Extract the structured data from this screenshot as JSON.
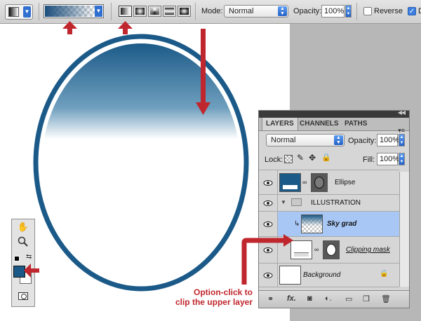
{
  "options_bar": {
    "mode_label": "Mode:",
    "mode_value": "Normal",
    "opacity_label": "Opacity:",
    "opacity_value": "100%",
    "reverse_label": "Reverse",
    "reverse_checked": false,
    "dither_label": "Di",
    "dither_checked": true,
    "gradient_types": [
      "linear-gradient-icon",
      "radial-gradient-icon",
      "angle-gradient-icon",
      "reflected-gradient-icon",
      "diamond-gradient-icon"
    ]
  },
  "colors": {
    "accent_blue": "#1b5a88",
    "arrow_red": "#c0262d",
    "selected_row": "#a8c7f5"
  },
  "layers_panel": {
    "tabs": [
      "LAYERS",
      "CHANNELS",
      "PATHS"
    ],
    "blend_mode": "Normal",
    "opacity_label": "Opacity:",
    "opacity_value": "100%",
    "lock_label": "Lock:",
    "fill_label": "Fill:",
    "fill_value": "100%",
    "layers": [
      {
        "name": "Ellipse",
        "kind": "shape"
      },
      {
        "name": "ILLUSTRATION",
        "kind": "group"
      },
      {
        "name": "Sky grad",
        "kind": "clipped",
        "selected": true
      },
      {
        "name": "Clipping mask",
        "kind": "mask"
      },
      {
        "name": "Background",
        "kind": "background",
        "locked": true
      }
    ],
    "bottom_icons": [
      "link-icon",
      "fx-icon",
      "add-mask-icon",
      "adjustment-icon",
      "group-icon",
      "new-layer-icon",
      "trash-icon"
    ]
  },
  "annotation": {
    "line1": "Option-click to",
    "line2": "clip the upper layer"
  }
}
